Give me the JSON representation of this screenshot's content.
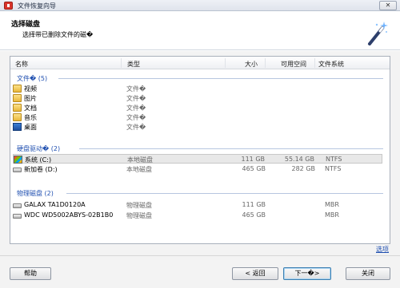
{
  "window": {
    "title": "文件恢复向导",
    "close_label": "✕"
  },
  "header": {
    "title": "选择磁盘",
    "subtitle": "选择带已删除文件的磁�"
  },
  "columns": {
    "name": "名称",
    "type": "类型",
    "size": "大小",
    "free": "可用空间",
    "fs": "文件系统"
  },
  "groups": {
    "files": {
      "label": "文件� (5)"
    },
    "drives": {
      "label": "硬盘驱动� (2)"
    },
    "physical": {
      "label": "物理磁盘 (2)"
    }
  },
  "files": [
    {
      "name": "视频",
      "type": "文件�",
      "icon": "folder-icon"
    },
    {
      "name": "图片",
      "type": "文件�",
      "icon": "folder-icon"
    },
    {
      "name": "文档",
      "type": "文件�",
      "icon": "folder-icon"
    },
    {
      "name": "音乐",
      "type": "文件�",
      "icon": "folder-icon"
    },
    {
      "name": "桌面",
      "type": "文件�",
      "icon": "desktop-icon"
    }
  ],
  "drives": [
    {
      "name": "系统 (C:)",
      "type": "本地磁盘",
      "size": "111 GB",
      "free": "55.14 GB",
      "fs": "NTFS",
      "icon": "system-drive-icon",
      "selected": true
    },
    {
      "name": "新加卷 (D:)",
      "type": "本地磁盘",
      "size": "465 GB",
      "free": "282 GB",
      "fs": "NTFS",
      "icon": "drive-icon"
    }
  ],
  "physical": [
    {
      "name": "GALAX TA1D0120A",
      "type": "物理磁盘",
      "size": "111 GB",
      "fs": "MBR",
      "icon": "disk-icon"
    },
    {
      "name": "WDC WD5002ABYS-02B1B0",
      "type": "物理磁盘",
      "size": "465 GB",
      "fs": "MBR",
      "icon": "disk-icon"
    }
  ],
  "options_link": "选项",
  "buttons": {
    "help": "帮助",
    "back": "< 返回",
    "next": "下一�>",
    "close": "关闭"
  }
}
